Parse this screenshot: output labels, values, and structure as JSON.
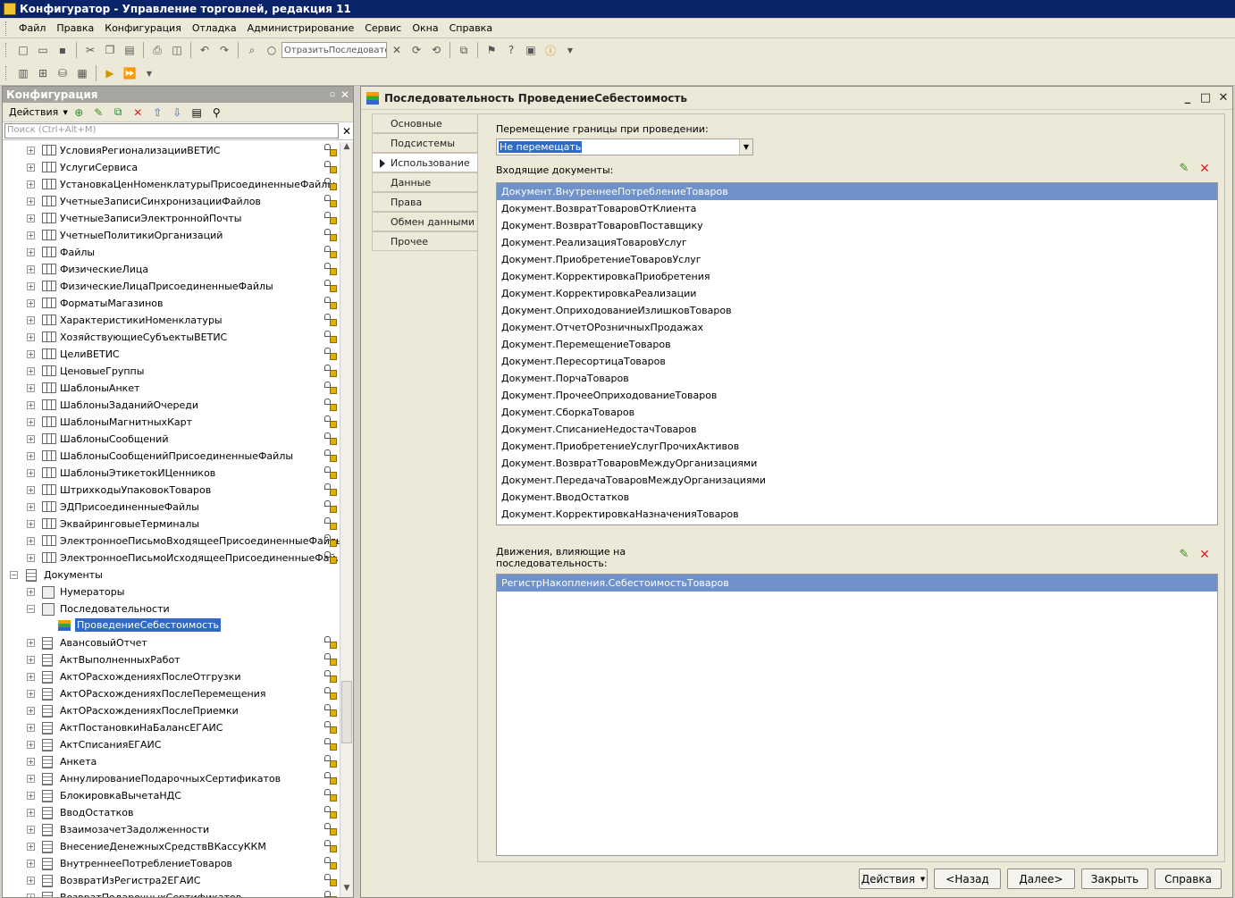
{
  "window": {
    "title": "Конфигуратор - Управление торговлей, редакция 11"
  },
  "menu": [
    "Файл",
    "Правка",
    "Конфигурация",
    "Отладка",
    "Администрирование",
    "Сервис",
    "Окна",
    "Справка"
  ],
  "toolbar": {
    "combo_value": "ОтразитьПоследовате"
  },
  "left_panel": {
    "title": "Конфигурация",
    "actions_label": "Действия",
    "search_placeholder": "Поиск (Ctrl+Alt+M)",
    "tree": [
      {
        "label": "УсловияРегионализацииВЕТИС",
        "kind": "catalog",
        "lock": true
      },
      {
        "label": "УслугиСервиса",
        "kind": "catalog",
        "lock": true
      },
      {
        "label": "УстановкаЦенНоменклатурыПрисоединенныеФайлы",
        "kind": "catalog",
        "lock": true
      },
      {
        "label": "УчетныеЗаписиСинхронизацииФайлов",
        "kind": "catalog",
        "lock": true
      },
      {
        "label": "УчетныеЗаписиЭлектроннойПочты",
        "kind": "catalog",
        "lock": true
      },
      {
        "label": "УчетныеПолитикиОрганизаций",
        "kind": "catalog",
        "lock": true
      },
      {
        "label": "Файлы",
        "kind": "catalog",
        "lock": true
      },
      {
        "label": "ФизическиеЛица",
        "kind": "catalog",
        "lock": true
      },
      {
        "label": "ФизическиеЛицаПрисоединенныеФайлы",
        "kind": "catalog",
        "lock": true
      },
      {
        "label": "ФорматыМагазинов",
        "kind": "catalog",
        "lock": true
      },
      {
        "label": "ХарактеристикиНоменклатуры",
        "kind": "catalog",
        "lock": true
      },
      {
        "label": "ХозяйствующиеСубъектыВЕТИС",
        "kind": "catalog",
        "lock": true
      },
      {
        "label": "ЦелиВЕТИС",
        "kind": "catalog",
        "lock": true
      },
      {
        "label": "ЦеновыеГруппы",
        "kind": "catalog",
        "lock": true
      },
      {
        "label": "ШаблоныАнкет",
        "kind": "catalog",
        "lock": true
      },
      {
        "label": "ШаблоныЗаданийОчереди",
        "kind": "catalog",
        "lock": true
      },
      {
        "label": "ШаблоныМагнитныхКарт",
        "kind": "catalog",
        "lock": true
      },
      {
        "label": "ШаблоныСообщений",
        "kind": "catalog",
        "lock": true
      },
      {
        "label": "ШаблоныСообщенийПрисоединенныеФайлы",
        "kind": "catalog",
        "lock": true
      },
      {
        "label": "ШаблоныЭтикетокИЦенников",
        "kind": "catalog",
        "lock": true
      },
      {
        "label": "ШтрихкодыУпаковокТоваров",
        "kind": "catalog",
        "lock": true
      },
      {
        "label": "ЭДПрисоединенныеФайлы",
        "kind": "catalog",
        "lock": true
      },
      {
        "label": "ЭквайринговыеТерминалы",
        "kind": "catalog",
        "lock": true
      },
      {
        "label": "ЭлектронноеПисьмоВходящееПрисоединенныеФайлы",
        "kind": "catalog",
        "lock": true
      },
      {
        "label": "ЭлектронноеПисьмоИсходящееПрисоединенныеФай...",
        "kind": "catalog",
        "lock": true
      },
      {
        "label": "Документы",
        "kind": "group",
        "lock": false
      },
      {
        "label": "Нумераторы",
        "kind": "numerators",
        "lock": false
      },
      {
        "label": "Последовательности",
        "kind": "sequences",
        "lock": false
      },
      {
        "label": "ПроведениеСебестоимость",
        "kind": "sequence-item",
        "lock": false
      },
      {
        "label": "АвансовыйОтчет",
        "kind": "doc",
        "lock": true
      },
      {
        "label": "АктВыполненныхРабот",
        "kind": "doc",
        "lock": true
      },
      {
        "label": "АктОРасхожденияхПослеОтгрузки",
        "kind": "doc",
        "lock": true
      },
      {
        "label": "АктОРасхожденияхПослеПеремещения",
        "kind": "doc",
        "lock": true
      },
      {
        "label": "АктОРасхожденияхПослеПриемки",
        "kind": "doc",
        "lock": true
      },
      {
        "label": "АктПостановкиНаБалансЕГАИС",
        "kind": "doc",
        "lock": true
      },
      {
        "label": "АктСписанияЕГАИС",
        "kind": "doc",
        "lock": true
      },
      {
        "label": "Анкета",
        "kind": "doc",
        "lock": true
      },
      {
        "label": "АннулированиеПодарочныхСертификатов",
        "kind": "doc",
        "lock": true
      },
      {
        "label": "БлокировкаВычетаНДС",
        "kind": "doc",
        "lock": true
      },
      {
        "label": "ВводОстатков",
        "kind": "doc",
        "lock": true
      },
      {
        "label": "ВзаимозачетЗадолженности",
        "kind": "doc",
        "lock": true
      },
      {
        "label": "ВнесениеДенежныхСредствВКассуККМ",
        "kind": "doc",
        "lock": true
      },
      {
        "label": "ВнутреннееПотреблениеТоваров",
        "kind": "doc",
        "lock": true
      },
      {
        "label": "ВозвратИзРегистра2ЕГАИС",
        "kind": "doc",
        "lock": true
      },
      {
        "label": "ВозвратПодарочныхСертификатов",
        "kind": "doc",
        "lock": true
      }
    ]
  },
  "editor": {
    "title": "Последовательность ПроведениеСебестоимость",
    "tabs": [
      "Основные",
      "Подсистемы",
      "Использование",
      "Данные",
      "Права",
      "Обмен данными",
      "Прочее"
    ],
    "active_tab": "Использование",
    "border_label": "Перемещение границы при проведении:",
    "border_value": "Не перемещать",
    "incoming_label": "Входящие  документы:",
    "incoming_docs": [
      "Документ.ВнутреннееПотреблениеТоваров",
      "Документ.ВозвратТоваровОтКлиента",
      "Документ.ВозвратТоваровПоставщику",
      "Документ.РеализацияТоваровУслуг",
      "Документ.ПриобретениеТоваровУслуг",
      "Документ.КорректировкаПриобретения",
      "Документ.КорректировкаРеализации",
      "Документ.ОприходованиеИзлишковТоваров",
      "Документ.ОтчетОРозничныхПродажах",
      "Документ.ПеремещениеТоваров",
      "Документ.ПересортицаТоваров",
      "Документ.ПорчаТоваров",
      "Документ.ПрочееОприходованиеТоваров",
      "Документ.СборкаТоваров",
      "Документ.СписаниеНедостачТоваров",
      "Документ.ПриобретениеУслугПрочихАктивов",
      "Документ.ВозвратТоваровМеждуОрганизациями",
      "Документ.ПередачаТоваровМеждуОрганизациями",
      "Документ.ВводОстатков",
      "Документ.КорректировкаНазначенияТоваров"
    ],
    "movements_label_1": "Движения, влияющие на",
    "movements_label_2": "последовательность:",
    "movements": [
      "РегистрНакопления.СебестоимостьТоваров"
    ],
    "buttons": {
      "actions": "Действия",
      "back": "<Назад",
      "next": "Далее>",
      "close": "Закрыть",
      "help": "Справка"
    }
  }
}
